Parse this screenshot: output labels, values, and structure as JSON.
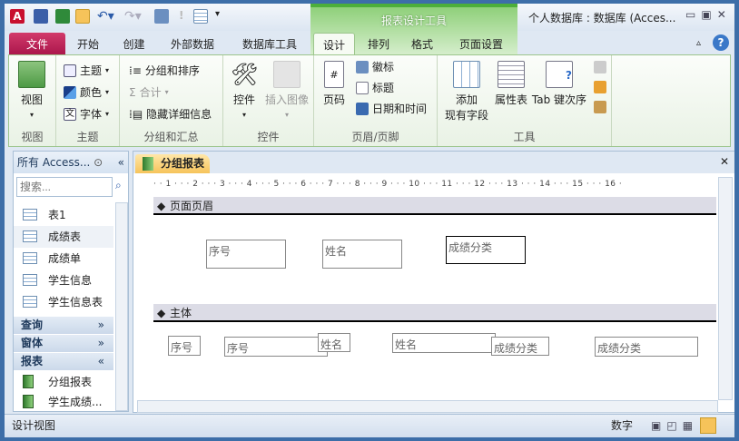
{
  "title": "个人数据库 : 数据库 (Acces...",
  "contextual_tab_group": "报表设计工具",
  "tabs": [
    "文件",
    "开始",
    "创建",
    "外部数据",
    "数据库工具",
    "设计",
    "排列",
    "格式",
    "页面设置"
  ],
  "ribbon": {
    "view": {
      "button": "视图",
      "group": "视图"
    },
    "theme": {
      "items": [
        "主题",
        "颜色",
        "字体"
      ],
      "group": "主题"
    },
    "grouping": {
      "items": [
        "分组和排序",
        "合计",
        "隐藏详细信息"
      ],
      "group": "分组和汇总"
    },
    "controls": {
      "items": [
        "控件",
        "插入图像"
      ],
      "group": "控件"
    },
    "header_footer": {
      "page_number": "页码",
      "items": [
        "徽标",
        "标题",
        "日期和时间"
      ],
      "group": "页眉/页脚"
    },
    "tools": {
      "add_fields_1": "添加",
      "add_fields_2": "现有字段",
      "property_sheet": "属性表",
      "tab_order": "Tab 键次序",
      "group": "工具"
    }
  },
  "nav": {
    "header": "所有 Access...",
    "search_placeholder": "搜索...",
    "tables": [
      "表1",
      "成绩表",
      "成绩单",
      "学生信息",
      "学生信息表"
    ],
    "groups": [
      "查询",
      "窗体",
      "报表"
    ],
    "reports": [
      "分组报表",
      "学生成绩..."
    ]
  },
  "document": {
    "tab": "分组报表",
    "ruler": "· · 1 · · · 2 · · · 3 · · · 4 · · · 5 · · · 6 · · · 7 · · · 8 · · · 9 · · · 10 · · · 11 · · · 12 · · · 13 · · · 14 · · · 15 · · · 16 ·",
    "sections": [
      "页面页眉",
      "主体"
    ],
    "header_controls": [
      "序号",
      "姓名",
      "成绩分类"
    ],
    "detail_controls": [
      "序号",
      "序号",
      "姓名",
      "姓名",
      "成绩分类",
      "成绩分类"
    ]
  },
  "status": {
    "left": "设计视图",
    "mode": "数字"
  }
}
